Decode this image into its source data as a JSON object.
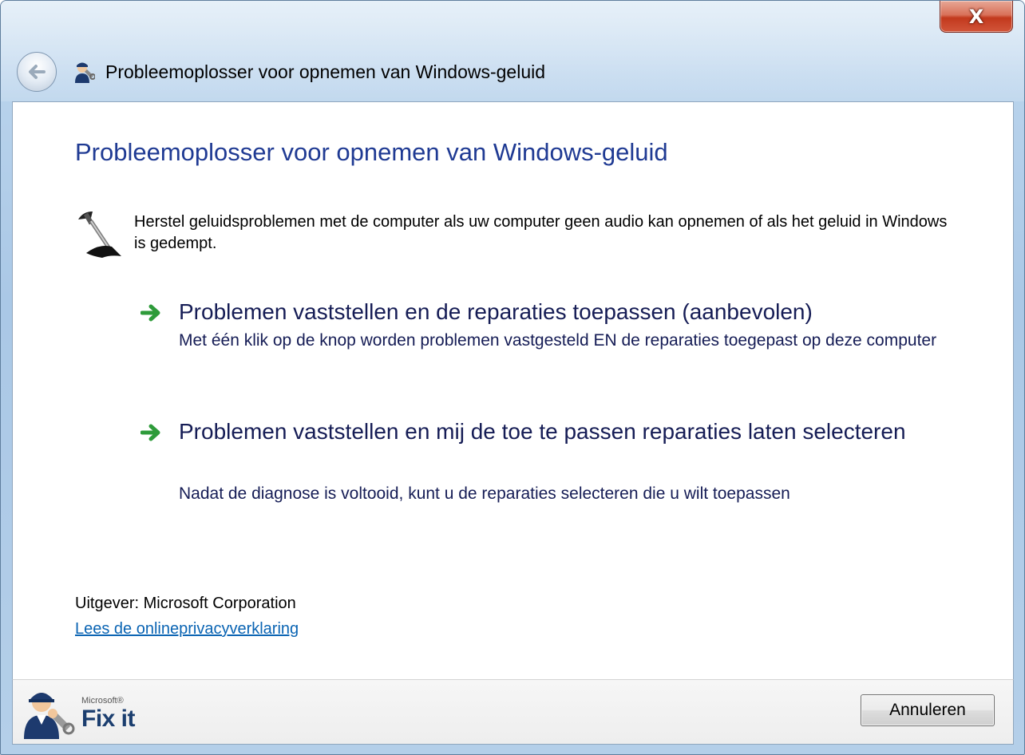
{
  "window": {
    "title": "Probleemoplosser voor opnemen van Windows-geluid",
    "close_glyph": "X"
  },
  "main": {
    "heading": "Probleemoplosser voor opnemen van Windows-geluid",
    "description": "Herstel geluidsproblemen met de computer als uw computer geen audio kan opnemen of als het geluid in Windows is gedempt.",
    "options": [
      {
        "title": "Problemen vaststellen en de reparaties toepassen (aanbevolen)",
        "subtitle": "Met één klik op de knop worden problemen vastgesteld EN de reparaties toegepast op deze computer"
      },
      {
        "title": "Problemen vaststellen en mij de toe te passen reparaties laten selecteren",
        "subtitle": "Nadat de diagnose is voltooid, kunt u de reparaties selecteren die u wilt toepassen"
      }
    ],
    "publisher": "Uitgever: Microsoft Corporation",
    "privacy_link": "Lees de onlineprivacyverklaring"
  },
  "footer": {
    "logo_brand": "Microsoft®",
    "logo_name": "Fix it",
    "cancel_label": "Annuleren"
  },
  "icons": {
    "back": "back-arrow-icon",
    "title": "troubleshooter-icon",
    "description": "microphone-icon",
    "option_arrow": "green-arrow-icon",
    "logo": "fixit-mascot-icon"
  },
  "colors": {
    "heading": "#1f3a93",
    "option_text": "#151c55",
    "link": "#0a64b3",
    "arrow": "#2e9b3a",
    "close_button": "#c2391d"
  }
}
